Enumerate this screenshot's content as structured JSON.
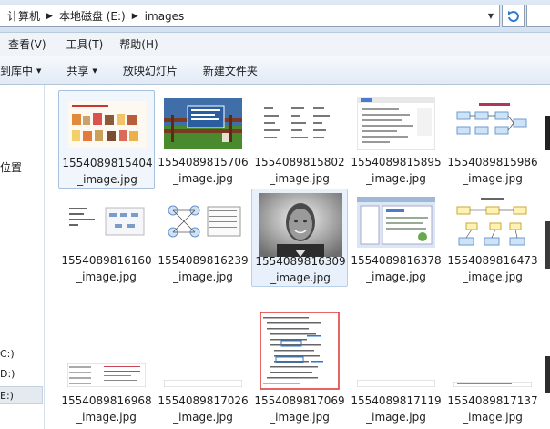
{
  "address": {
    "crumbs": [
      "计算机",
      "本地磁盘 (E:)",
      "images"
    ]
  },
  "menu": [
    "查看(V)",
    "工具(T)",
    "帮助(H)"
  ],
  "toolbar": {
    "add_to_library": "到库中",
    "share": "共享",
    "slideshow": "放映幻灯片",
    "new_folder": "新建文件夹"
  },
  "nav": {
    "location": "位置",
    "drives": [
      "C:)",
      "D:)",
      "E:)"
    ]
  },
  "files": [
    {
      "id": "1554089815404",
      "ext": "_image.jpg",
      "thumb": "products"
    },
    {
      "id": "1554089815706",
      "ext": "_image.jpg",
      "thumb": "sign"
    },
    {
      "id": "1554089815802",
      "ext": "_image.jpg",
      "thumb": "textdoc"
    },
    {
      "id": "1554089815895",
      "ext": "_image.jpg",
      "thumb": "webpage"
    },
    {
      "id": "1554089815986",
      "ext": "_image.jpg",
      "thumb": "flowchart"
    },
    {
      "id": "1554089816160",
      "ext": "_image.jpg",
      "thumb": "textchart"
    },
    {
      "id": "1554089816239",
      "ext": "_image.jpg",
      "thumb": "network"
    },
    {
      "id": "1554089816309",
      "ext": "_image.jpg",
      "thumb": "portrait"
    },
    {
      "id": "1554089816378",
      "ext": "_image.jpg",
      "thumb": "software"
    },
    {
      "id": "1554089816473",
      "ext": "_image.jpg",
      "thumb": "architecture"
    },
    {
      "id": "1554089816968",
      "ext": "_image.jpg",
      "thumb": "table"
    },
    {
      "id": "1554089817026",
      "ext": "_image.jpg",
      "thumb": "strip"
    },
    {
      "id": "1554089817069",
      "ext": "_image.jpg",
      "thumb": "code"
    },
    {
      "id": "1554089817119",
      "ext": "_image.jpg",
      "thumb": "strip2"
    },
    {
      "id": "1554089817137",
      "ext": "_image.jpg",
      "thumb": "strip3"
    }
  ]
}
